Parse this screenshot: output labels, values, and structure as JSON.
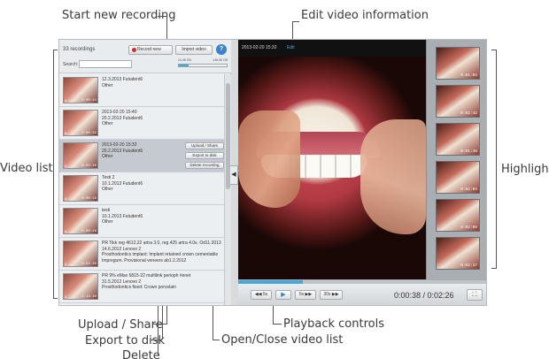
{
  "callouts": {
    "start_recording": "Start new recording",
    "edit_info": "Edit video information",
    "video_list": "Video list",
    "highlights": "Highlights",
    "upload_share": "Upload / Share",
    "export_disk": "Export to disk",
    "delete": "Delete",
    "playback": "Playback controls",
    "open_close": "Open/Close video list"
  },
  "header": {
    "count": "33 recordings",
    "record_btn": "Record new",
    "import_btn": "Import video",
    "help_btn": "?",
    "search_label": "Search:",
    "search_value": "",
    "disk_left": "24,48 GB",
    "disk_right": "148,95 GB",
    "disk_used_fraction": 0.2
  },
  "recordings": [
    {
      "num": "4",
      "duration": "0:00:44",
      "title": "12.3.2013 Futudent6",
      "l2": "Other",
      "l3": "",
      "l4": ""
    },
    {
      "num": "8",
      "duration": "0:00:32",
      "title": "2013-02-20 15:40",
      "l2": "20.2.2013 Futudent6",
      "l3": "Other",
      "l4": ""
    },
    {
      "num": "4",
      "duration": "0:02:26",
      "title": "2013-02-20 15:32",
      "l2": "20.2.2013 Futudent6",
      "l3": "Other",
      "l4": ""
    },
    {
      "num": "4",
      "duration": "0:00:16",
      "title": "Testi 2",
      "l2": "10.1.2013 Futudent6",
      "l3": "Other",
      "l4": ""
    },
    {
      "num": "4",
      "duration": "0:00:16",
      "title": "testi",
      "l2": "10.1.2013 Futudent6",
      "l3": "Other",
      "l4": ""
    },
    {
      "num": "2",
      "duration": "0:02:26",
      "title": "PR Tikk reg 4612,22 artra 3.0, reg 425 artra 4.0s. Od11.2013",
      "l2": "14.6.2012 Lenovo 2",
      "l3": "Prosthodontics implant: Implant retained crown cementable",
      "l4": "Impregum. Provisional veneers ab1.2.2012"
    },
    {
      "num": "3",
      "duration": "1:13:40",
      "title": "PR 9% eMax 6815-22 multilink perioph #enet",
      "l2": "31.5.2012 Lenovo 2",
      "l3": "Prosthodontics fixed: Crown porcelain",
      "l4": ""
    }
  ],
  "row_actions": {
    "upload": "Upload / Share",
    "export": "Export to disk",
    "delete": "Delete recording"
  },
  "toggle_list": "◀",
  "video": {
    "timestamp": "2013-02-20 15:32",
    "edit": "Edit",
    "progress_fraction": 0.26
  },
  "highlights": [
    {
      "duration": "0:01:04"
    },
    {
      "duration": "0:02:42"
    },
    {
      "duration": "0:01:48"
    },
    {
      "duration": "0:02:04"
    },
    {
      "duration": "0:02:08"
    },
    {
      "duration": "0:02:17"
    }
  ],
  "controls": {
    "back5": "◀◀ 5s",
    "play": "▶",
    "fwd5": "5s ▶▶",
    "fwd30": "30s ▶▶",
    "time": "0:00:38 / 0:02:26",
    "fullscreen": "⛶"
  }
}
